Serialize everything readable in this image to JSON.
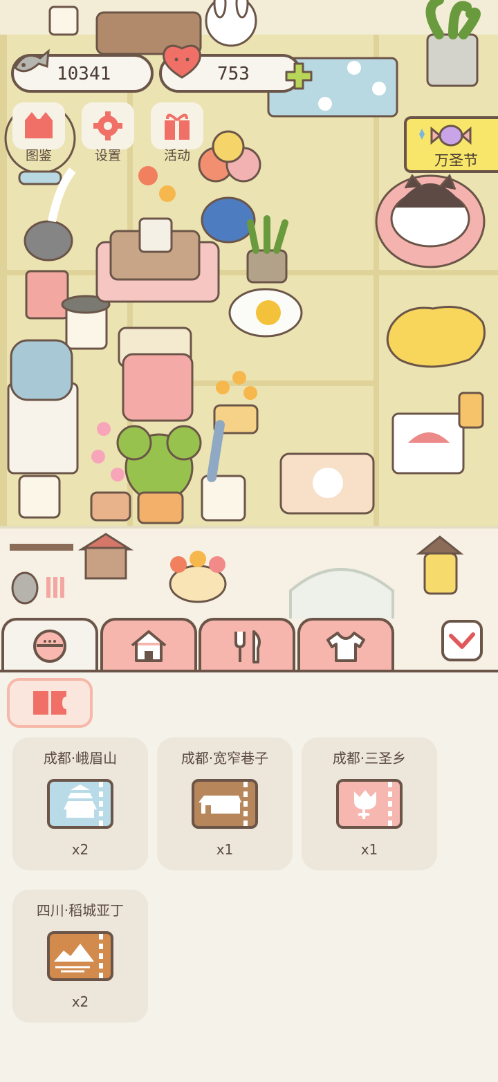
{
  "currency": {
    "fish": "10341",
    "hearts": "753"
  },
  "top_buttons": [
    {
      "label": "图鉴",
      "icon": "cat-face-icon"
    },
    {
      "label": "设置",
      "icon": "gear-icon"
    },
    {
      "label": "活动",
      "icon": "gift-icon"
    }
  ],
  "event_banner": {
    "label": "万圣节"
  },
  "tabs": [
    {
      "icon": "bowl-icon",
      "active": true
    },
    {
      "icon": "house-icon",
      "active": false
    },
    {
      "icon": "utensils-icon",
      "active": false
    },
    {
      "icon": "shirt-icon",
      "active": false
    }
  ],
  "panel": {
    "filter_icon": "ticket-filter-icon",
    "cards": [
      {
        "title": "成都·峨眉山",
        "count": "x2",
        "ticket_color": "#b9dbe8",
        "icon": "temple-icon"
      },
      {
        "title": "成都·宽窄巷子",
        "count": "x1",
        "ticket_color": "#b7875b",
        "icon": "street-icon"
      },
      {
        "title": "成都·三圣乡",
        "count": "x1",
        "ticket_color": "#f6b7b1",
        "icon": "flower-icon"
      },
      {
        "title": "四川·稻城亚丁",
        "count": "x2",
        "ticket_color": "#d28a4d",
        "icon": "mountain-icon"
      }
    ]
  },
  "colors": {
    "outline": "#6b5548",
    "tab_pink": "#f6b6ad",
    "cream": "#f5f2ea",
    "floor": "#ece3b2"
  }
}
